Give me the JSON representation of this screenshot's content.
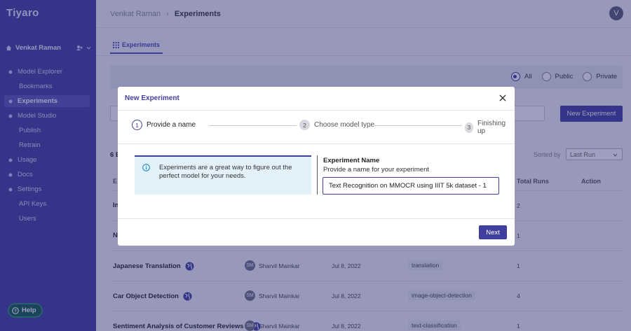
{
  "app": {
    "logo": "Tiyaro"
  },
  "sidebar": {
    "user_name": "Venkat Raman",
    "items": [
      {
        "label": "Model Explorer",
        "sub": false,
        "active": false
      },
      {
        "label": "Bookmarks",
        "sub": true,
        "active": false
      },
      {
        "label": "Experiments",
        "sub": false,
        "active": true
      },
      {
        "label": "Model Studio",
        "sub": false,
        "active": false
      },
      {
        "label": "Publish",
        "sub": true,
        "active": false
      },
      {
        "label": "Retrain",
        "sub": true,
        "active": false
      },
      {
        "label": "Usage",
        "sub": false,
        "active": false
      },
      {
        "label": "Docs",
        "sub": false,
        "active": false
      },
      {
        "label": "Settings",
        "sub": false,
        "active": false
      },
      {
        "label": "API Keys",
        "sub": true,
        "active": false
      },
      {
        "label": "Users",
        "sub": true,
        "active": false
      }
    ],
    "help_label": "Help"
  },
  "header": {
    "breadcrumb_parent": "Venkat Raman",
    "breadcrumb_current": "Experiments",
    "avatar_initial": "V"
  },
  "tabs": [
    {
      "label": "Experiments"
    }
  ],
  "filters": {
    "options": [
      "All",
      "Public",
      "Private"
    ],
    "selected": "All"
  },
  "toolbar": {
    "new_experiment_label": "New Experiment"
  },
  "list": {
    "count_prefix": "6 E",
    "sorted_by_label": "Sorted by",
    "sort_value": "Last Run",
    "columns": {
      "name": "E",
      "total_runs": "Total Runs",
      "action": "Action"
    },
    "rows": [
      {
        "name": "In",
        "owner": "",
        "initials": "",
        "date": "",
        "task": "",
        "runs": "2"
      },
      {
        "name": "N",
        "owner": "",
        "initials": "",
        "date": "",
        "task": "",
        "runs": "1"
      },
      {
        "name": "Japanese Translation",
        "owner": "Sharvil Mainkar",
        "initials": "SM",
        "date": "Jul 8, 2022",
        "task": "translation",
        "runs": "1"
      },
      {
        "name": "Car Object Detection",
        "owner": "Sharvil Mainkar",
        "initials": "SM",
        "date": "Jul 8, 2022",
        "task": "image-object-detection",
        "runs": "4"
      },
      {
        "name": "Sentiment Analysis of Customer Reviews f",
        "owner": "Sharvil Mainkar",
        "initials": "SM",
        "date": "Jul 8, 2022",
        "task": "text-classification",
        "runs": "1"
      }
    ]
  },
  "modal": {
    "title": "New Experiment",
    "steps": [
      {
        "num": "1",
        "label": "Provide a name",
        "active": true
      },
      {
        "num": "2",
        "label": "Choose model type",
        "active": false
      },
      {
        "num": "3",
        "label": "Finishing up",
        "active": false
      }
    ],
    "info_text": "Experiments are a great way to figure out the perfect model for your needs.",
    "field_title": "Experiment Name",
    "field_subtitle": "Provide a name for your experiment",
    "field_value": "Text Recognition on MMOCR using IIIT 5k dataset - 1",
    "next_label": "Next"
  },
  "colors": {
    "accent": "#3e3f9e",
    "sidebar_bg": "#3e3f9e",
    "help_bg": "#0e5a48"
  },
  "icons": {
    "close": "close-icon",
    "info": "info-icon",
    "globe": "globe-icon",
    "grid": "grid-icon"
  }
}
